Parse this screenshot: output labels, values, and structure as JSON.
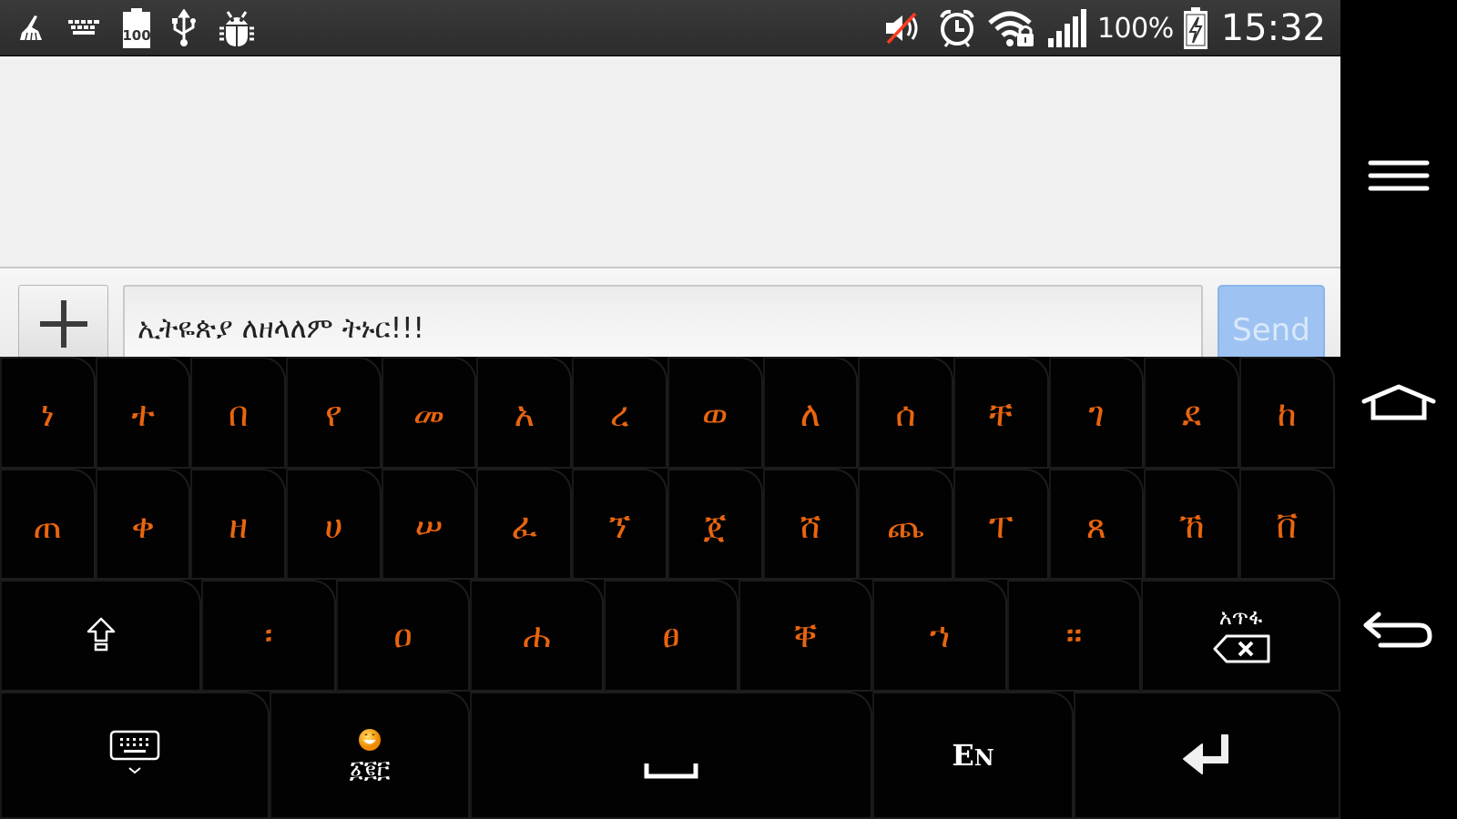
{
  "status_bar": {
    "left_icons": [
      "cleaner-broom-icon",
      "keyboard-icon",
      "battery-100-icon",
      "usb-icon",
      "debug-bug-icon"
    ],
    "battery_notification_label": "100",
    "right_icons": [
      "volume-muted-icon",
      "alarm-clock-icon",
      "wifi-locked-icon",
      "cell-signal-icon",
      "battery-charging-icon"
    ],
    "battery_percent": "100%",
    "time": "15:32"
  },
  "app": {
    "attach_button_icon": "plus-icon",
    "message_input_value": "ኢትዬጵያ ለዘላለም ትኑር!!!",
    "send_label": "Send",
    "colors": {
      "send_bg": "#9ec3f2",
      "send_text": "#d9e8fb"
    }
  },
  "navbar": {
    "menu_icon": "menu-icon",
    "home_icon": "home-icon",
    "back_icon": "back-icon"
  },
  "keyboard": {
    "accent_color": "#e8650f",
    "row1": [
      "ነ",
      "ተ",
      "በ",
      "የ",
      "መ",
      "አ",
      "ረ",
      "ወ",
      "ለ",
      "ሰ",
      "ቸ",
      "ገ",
      "ደ",
      "ከ"
    ],
    "row2": [
      "ጠ",
      "ቀ",
      "ዘ",
      "ሀ",
      "ሠ",
      "ፈ",
      "ኘ",
      "ጀ",
      "ሸ",
      "ጨ",
      "ፐ",
      "ጸ",
      "ኸ",
      "ቨ"
    ],
    "row3": {
      "shift_icon": "shift-icon",
      "keys": [
        "፡",
        "ዐ",
        "ሐ",
        "ፀ",
        "ቐ",
        "ኀ",
        "።"
      ],
      "delete_label": "አጥፋ",
      "delete_icon": "backspace-icon"
    },
    "row4": {
      "hide_keyboard_icon": "keyboard-hide-icon",
      "emoji_label": "፩፪፫",
      "emoji_icon": "emoji-smiley-icon",
      "space_icon": "space-bar-icon",
      "language_label_big": "E",
      "language_label_small": "N",
      "enter_icon": "enter-icon"
    }
  }
}
